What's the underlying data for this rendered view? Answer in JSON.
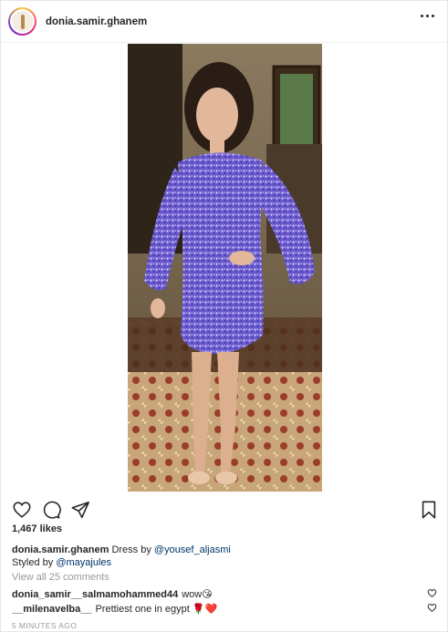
{
  "header": {
    "username": "donia.samir.ghanem"
  },
  "post": {
    "likes": "1,467 likes",
    "caption": {
      "user": "donia.samir.ghanem",
      "text_before": "Dress by",
      "mention1": "@yousef_aljasmi",
      "line2_prefix": "Styled by",
      "mention2": "@mayajules"
    },
    "view_all": "View all 25 comments",
    "comments": [
      {
        "user": "donia_samir__salmamohammed44",
        "text": "wow😘"
      },
      {
        "user": "__milenavelba__",
        "text": "Prettiest one in egypt 🌹❤️"
      }
    ],
    "timestamp": "5 MINUTES AGO"
  },
  "icons": [
    "more-icon",
    "heart-icon",
    "comment-icon",
    "share-icon",
    "bookmark-icon"
  ],
  "colors": {
    "text": "#262626",
    "muted": "#999999",
    "link": "#003569",
    "dress": "#6a5acd"
  }
}
